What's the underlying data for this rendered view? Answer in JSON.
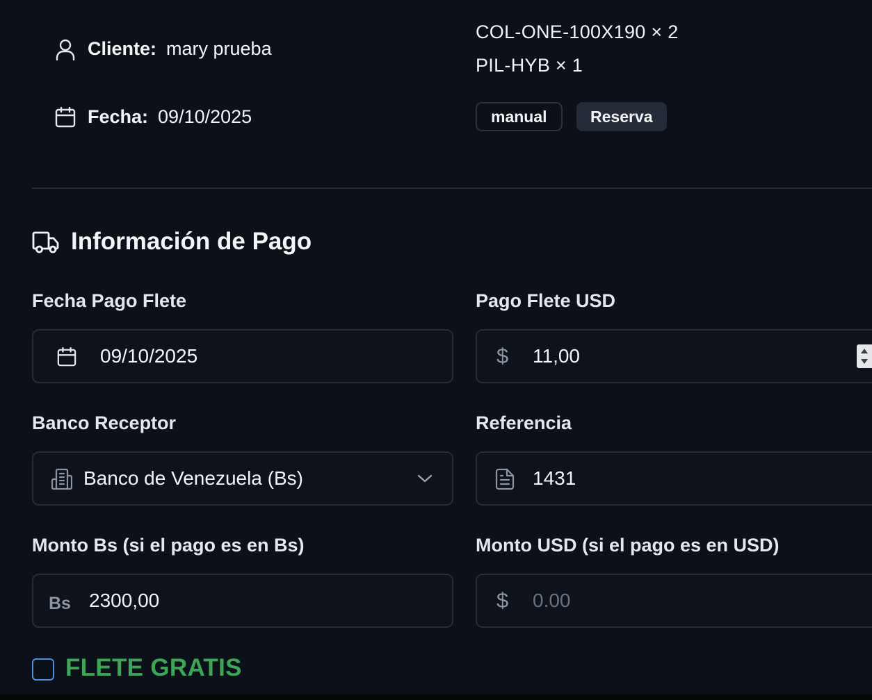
{
  "summary": {
    "client_label": "Cliente:",
    "client_value": "mary prueba",
    "date_label": "Fecha:",
    "date_value": "09/10/2025",
    "products": [
      "COL-ONE-100X190 × 2",
      "PIL-HYB × 1"
    ],
    "badges": [
      "manual",
      "Reserva"
    ]
  },
  "payment": {
    "title": "Información de Pago",
    "fecha_pago_flete": {
      "label": "Fecha Pago Flete",
      "value": "09/10/2025"
    },
    "pago_flete_usd": {
      "label": "Pago Flete USD",
      "prefix": "$",
      "value": "11,00"
    },
    "banco_receptor": {
      "label": "Banco Receptor",
      "selected": "Banco de Venezuela (Bs)"
    },
    "referencia": {
      "label": "Referencia",
      "value": "1431"
    },
    "monto_bs": {
      "label": "Monto Bs (si el pago es en Bs)",
      "prefix": "Bs",
      "value": "2300,00"
    },
    "monto_usd": {
      "label": "Monto USD (si el pago es en USD)",
      "prefix": "$",
      "placeholder": "0.00"
    },
    "flete_gratis": {
      "label": "FLETE GRATIS",
      "checked": false
    }
  },
  "colors": {
    "background": "#0c1119",
    "border": "#262c38",
    "checkbox_border": "#4a90e2",
    "flete_gratis_text": "#3fa556",
    "muted_icon": "#8d95a3"
  },
  "icons": {
    "client": "user-icon",
    "date": "calendar-icon",
    "section": "truck-icon",
    "bank": "building-icon",
    "reference": "document-icon",
    "select": "chevron-down-icon"
  }
}
